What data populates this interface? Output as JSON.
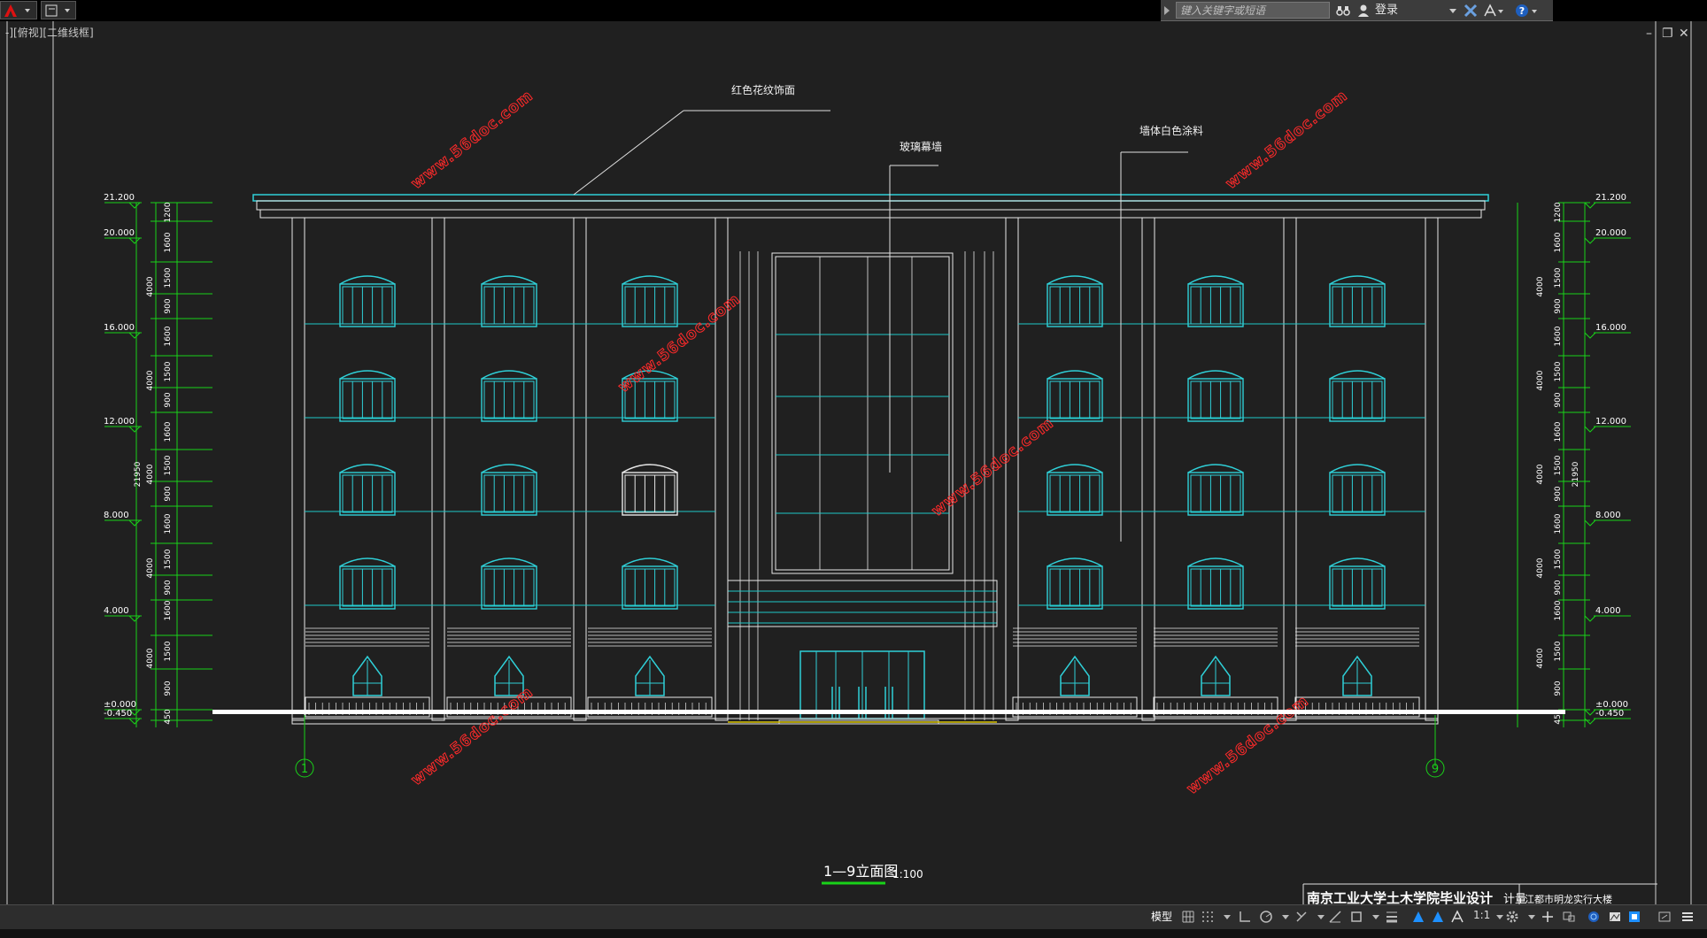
{
  "ui": {
    "search_placeholder": "键入关键字或短语",
    "login_label": "登录",
    "view_label": "-][俯视][二维线框]",
    "model_tab": "模型",
    "scale": "1:1"
  },
  "drawing": {
    "annotations": {
      "roof_finish": "红色花纹饰面",
      "curtain_wall": "玻璃幕墙",
      "wall_paint": "墙体白色涂料"
    },
    "title": "1—9立面图",
    "scale": "1:100",
    "axis_left": "1",
    "axis_right": "9",
    "titleblock_text": "南京工业大学土木学院毕业设计",
    "titleblock_small": "计量",
    "titleblock_right": "江都市明龙实行大楼",
    "watermark": "www.56doc.com",
    "elevations_left": [
      "21.200",
      "20.000",
      "16.000",
      "12.000",
      "8.000",
      "4.000",
      "±0.000",
      "-0.450"
    ],
    "elevations_right": [
      "21.200",
      "20.000",
      "16.000",
      "12.000",
      "8.000",
      "4.000",
      "±0.000",
      "-0.450"
    ],
    "dims_inner": [
      "1200",
      "1600",
      "1500",
      "900",
      "1600",
      "1500",
      "900",
      "1600",
      "1500",
      "900",
      "1600",
      "1500",
      "900",
      "1600",
      "1500",
      "900",
      "450"
    ],
    "dims_middle": [
      "4000",
      "4000",
      "4000",
      "4000",
      "4000"
    ],
    "dim_total": "21950"
  }
}
